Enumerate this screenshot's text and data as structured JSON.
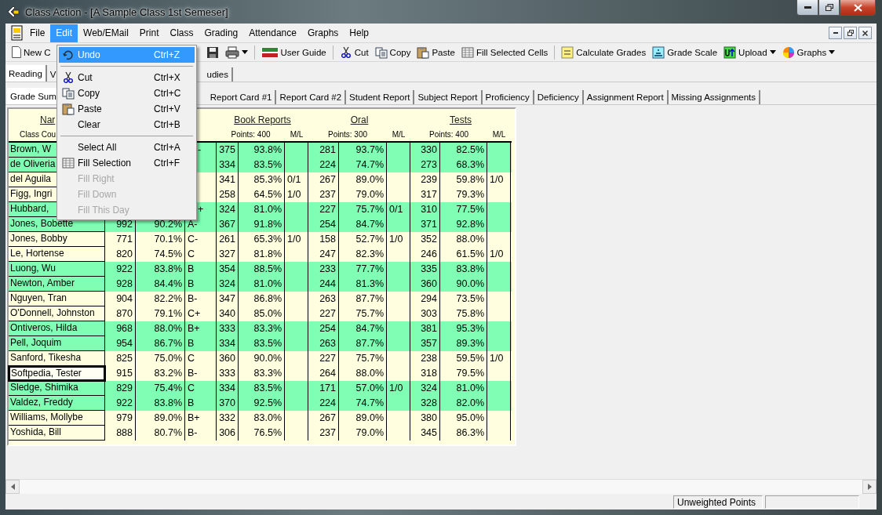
{
  "window": {
    "title": "Class Action - [A Sample Class 1st Semeser]"
  },
  "menu_bar": [
    {
      "label": "File",
      "selected": false
    },
    {
      "label": "Edit",
      "selected": true
    },
    {
      "label": "Web/EMail",
      "selected": false
    },
    {
      "label": "Print",
      "selected": false
    },
    {
      "label": "Class",
      "selected": false
    },
    {
      "label": "Grading",
      "selected": false
    },
    {
      "label": "Attendance",
      "selected": false
    },
    {
      "label": "Graphs",
      "selected": false
    },
    {
      "label": "Help",
      "selected": false
    }
  ],
  "edit_menu": [
    {
      "kind": "item",
      "label": "Undo",
      "shortcut": "Ctrl+Z",
      "selected": true,
      "disabled": false
    },
    {
      "kind": "separator"
    },
    {
      "kind": "item",
      "label": "Cut",
      "shortcut": "Ctrl+X",
      "selected": false,
      "disabled": false
    },
    {
      "kind": "item",
      "label": "Copy",
      "shortcut": "Ctrl+C",
      "selected": false,
      "disabled": false
    },
    {
      "kind": "item",
      "label": "Paste",
      "shortcut": "Ctrl+V",
      "selected": false,
      "disabled": false
    },
    {
      "kind": "item",
      "label": "Clear",
      "shortcut": "Ctrl+B",
      "selected": false,
      "disabled": false
    },
    {
      "kind": "separator"
    },
    {
      "kind": "item",
      "label": "Select All",
      "shortcut": "Ctrl+A",
      "selected": false,
      "disabled": false
    },
    {
      "kind": "item",
      "label": "Fill Selection",
      "shortcut": "Ctrl+F",
      "selected": false,
      "disabled": false
    },
    {
      "kind": "item",
      "label": "Fill Right",
      "selected": false,
      "disabled": true
    },
    {
      "kind": "item",
      "label": "Fill Down",
      "selected": false,
      "disabled": true
    },
    {
      "kind": "item",
      "label": "Fill This Day",
      "selected": false,
      "disabled": true
    }
  ],
  "toolbar_left": {
    "label": "New C"
  },
  "toolbar": [
    {
      "kind": "icon"
    },
    {
      "kind": "dropdown-icon"
    },
    {
      "kind": "separator"
    },
    {
      "kind": "button",
      "label": "User Guide"
    },
    {
      "kind": "separator"
    },
    {
      "kind": "button",
      "label": "Cut"
    },
    {
      "kind": "button",
      "label": "Copy"
    },
    {
      "kind": "button",
      "label": "Paste"
    },
    {
      "kind": "button",
      "label": "Fill Selected Cells"
    },
    {
      "kind": "separator"
    },
    {
      "kind": "button",
      "label": "Calculate Grades"
    },
    {
      "kind": "button",
      "label": "Grade Scale"
    },
    {
      "kind": "dropdown",
      "label": "Upload"
    },
    {
      "kind": "dropdown",
      "label": "Graphs"
    }
  ],
  "subject_tabs": {
    "left": [
      {
        "label": "Reading",
        "selected": true
      },
      {
        "label": "V",
        "selected": false
      }
    ],
    "right": [
      {
        "label": "udies",
        "selected": false
      }
    ]
  },
  "report_tabs": {
    "left": [
      {
        "label": "Grade Sum",
        "selected": true
      }
    ],
    "right": [
      {
        "label": "Report Card #1",
        "selected": false
      },
      {
        "label": "Report Card #2",
        "selected": false
      },
      {
        "label": "Student Report",
        "selected": false
      },
      {
        "label": "Subject Report",
        "selected": false
      },
      {
        "label": "Proficiency",
        "selected": false
      },
      {
        "label": "Deficiency",
        "selected": false
      },
      {
        "label": "Assignment Report",
        "selected": false
      },
      {
        "label": "Missing Assignments",
        "selected": false
      }
    ]
  },
  "table": {
    "name_header": "Nar",
    "name_subheader": "Class Cou",
    "groups": [
      {
        "title": "Book Reports",
        "points": "Points: 400",
        "ml": "M/L"
      },
      {
        "title": "Oral",
        "points": "Points: 300",
        "ml": "M/L"
      },
      {
        "title": "Tests",
        "points": "Points: 400",
        "ml": "M/L"
      }
    ],
    "rows": [
      {
        "name": "Brown, W",
        "grade": "-",
        "selected": false,
        "scores": [
          {
            "points": "375",
            "percent": "93.8%"
          },
          {
            "points": "281",
            "percent": "93.7%"
          },
          {
            "points": "330",
            "percent": "82.5%"
          }
        ]
      },
      {
        "name": "de Oliveria",
        "selected": false,
        "scores": [
          {
            "points": "334",
            "percent": "83.5%"
          },
          {
            "points": "224",
            "percent": "74.7%"
          },
          {
            "points": "273",
            "percent": "68.3%"
          }
        ]
      },
      {
        "name": "del Aguila",
        "selected": false,
        "scores": [
          {
            "points": "341",
            "percent": "85.3%",
            "ml": "0/1"
          },
          {
            "points": "267",
            "percent": "89.0%"
          },
          {
            "points": "239",
            "percent": "59.8%",
            "ml": "1/0"
          }
        ]
      },
      {
        "name": "Figg, Ingri",
        "selected": false,
        "scores": [
          {
            "points": "258",
            "percent": "64.5%",
            "ml": "1/0"
          },
          {
            "points": "237",
            "percent": "79.0%"
          },
          {
            "points": "317",
            "percent": "79.3%"
          }
        ]
      },
      {
        "name": "Hubbard,",
        "grade": "+",
        "selected": false,
        "scores": [
          {
            "points": "324",
            "percent": "81.0%"
          },
          {
            "points": "227",
            "percent": "75.7%",
            "ml": "0/1"
          },
          {
            "points": "310",
            "percent": "77.5%"
          }
        ]
      },
      {
        "name": "Jones, Bobette",
        "total": "992",
        "percent": "90.2%",
        "grade": "A-",
        "selected": false,
        "scores": [
          {
            "points": "367",
            "percent": "91.8%"
          },
          {
            "points": "254",
            "percent": "84.7%"
          },
          {
            "points": "371",
            "percent": "92.8%"
          }
        ]
      },
      {
        "name": "Jones, Bobby",
        "total": "771",
        "percent": "70.1%",
        "grade": "C-",
        "selected": false,
        "scores": [
          {
            "points": "261",
            "percent": "65.3%",
            "ml": "1/0"
          },
          {
            "points": "158",
            "percent": "52.7%",
            "ml": "1/0"
          },
          {
            "points": "352",
            "percent": "88.0%"
          }
        ]
      },
      {
        "name": "Le, Hortense",
        "total": "820",
        "percent": "74.5%",
        "grade": "C",
        "selected": false,
        "scores": [
          {
            "points": "327",
            "percent": "81.8%"
          },
          {
            "points": "247",
            "percent": "82.3%"
          },
          {
            "points": "246",
            "percent": "61.5%",
            "ml": "1/0"
          }
        ]
      },
      {
        "name": "Luong, Wu",
        "total": "922",
        "percent": "83.8%",
        "grade": "B",
        "selected": false,
        "scores": [
          {
            "points": "354",
            "percent": "88.5%"
          },
          {
            "points": "233",
            "percent": "77.7%"
          },
          {
            "points": "335",
            "percent": "83.8%"
          }
        ]
      },
      {
        "name": "Newton, Amber",
        "total": "928",
        "percent": "84.4%",
        "grade": "B",
        "selected": false,
        "scores": [
          {
            "points": "324",
            "percent": "81.0%"
          },
          {
            "points": "244",
            "percent": "81.3%"
          },
          {
            "points": "360",
            "percent": "90.0%"
          }
        ]
      },
      {
        "name": "Nguyen, Tran",
        "total": "904",
        "percent": "82.2%",
        "grade": "B-",
        "selected": false,
        "scores": [
          {
            "points": "347",
            "percent": "86.8%"
          },
          {
            "points": "263",
            "percent": "87.7%"
          },
          {
            "points": "294",
            "percent": "73.5%"
          }
        ]
      },
      {
        "name": "O'Donnell, Johnston",
        "total": "870",
        "percent": "79.1%",
        "grade": "C+",
        "selected": false,
        "scores": [
          {
            "points": "340",
            "percent": "85.0%"
          },
          {
            "points": "227",
            "percent": "75.7%"
          },
          {
            "points": "303",
            "percent": "75.8%"
          }
        ]
      },
      {
        "name": "Ontiveros, Hilda",
        "total": "968",
        "percent": "88.0%",
        "grade": "B+",
        "selected": false,
        "scores": [
          {
            "points": "333",
            "percent": "83.3%"
          },
          {
            "points": "254",
            "percent": "84.7%"
          },
          {
            "points": "381",
            "percent": "95.3%"
          }
        ]
      },
      {
        "name": "Pell, Joquim",
        "total": "954",
        "percent": "86.7%",
        "grade": "B",
        "selected": false,
        "scores": [
          {
            "points": "334",
            "percent": "83.5%"
          },
          {
            "points": "263",
            "percent": "87.7%"
          },
          {
            "points": "357",
            "percent": "89.3%"
          }
        ]
      },
      {
        "name": "Sanford, Tikesha",
        "total": "825",
        "percent": "75.0%",
        "grade": "C",
        "selected": false,
        "scores": [
          {
            "points": "360",
            "percent": "90.0%"
          },
          {
            "points": "227",
            "percent": "75.7%"
          },
          {
            "points": "238",
            "percent": "59.5%",
            "ml": "1/0"
          }
        ]
      },
      {
        "name": "Softpedia, Tester",
        "total": "915",
        "percent": "83.2%",
        "grade": "B-",
        "selected": true,
        "scores": [
          {
            "points": "333",
            "percent": "83.3%"
          },
          {
            "points": "264",
            "percent": "88.0%"
          },
          {
            "points": "318",
            "percent": "79.5%"
          }
        ]
      },
      {
        "name": "Sledge, Shimika",
        "total": "829",
        "percent": "75.4%",
        "grade": "C",
        "selected": false,
        "scores": [
          {
            "points": "334",
            "percent": "83.5%"
          },
          {
            "points": "171",
            "percent": "57.0%",
            "ml": "1/0"
          },
          {
            "points": "324",
            "percent": "81.0%"
          }
        ]
      },
      {
        "name": "Valdez, Freddy",
        "total": "922",
        "percent": "83.8%",
        "grade": "B",
        "selected": false,
        "scores": [
          {
            "points": "370",
            "percent": "92.5%"
          },
          {
            "points": "224",
            "percent": "74.7%"
          },
          {
            "points": "328",
            "percent": "82.0%"
          }
        ]
      },
      {
        "name": "Williams, Mollybe",
        "total": "979",
        "percent": "89.0%",
        "grade": "B+",
        "selected": false,
        "scores": [
          {
            "points": "332",
            "percent": "83.0%"
          },
          {
            "points": "267",
            "percent": "89.0%"
          },
          {
            "points": "380",
            "percent": "95.0%"
          }
        ]
      },
      {
        "name": "Yoshida,  Bill",
        "total": "888",
        "percent": "80.7%",
        "grade": "B-",
        "selected": false,
        "scores": [
          {
            "points": "306",
            "percent": "76.5%"
          },
          {
            "points": "237",
            "percent": "79.0%"
          },
          {
            "points": "345",
            "percent": "86.3%"
          }
        ]
      }
    ]
  },
  "status_bar": {
    "panels": [
      "Unweighted Points"
    ]
  }
}
